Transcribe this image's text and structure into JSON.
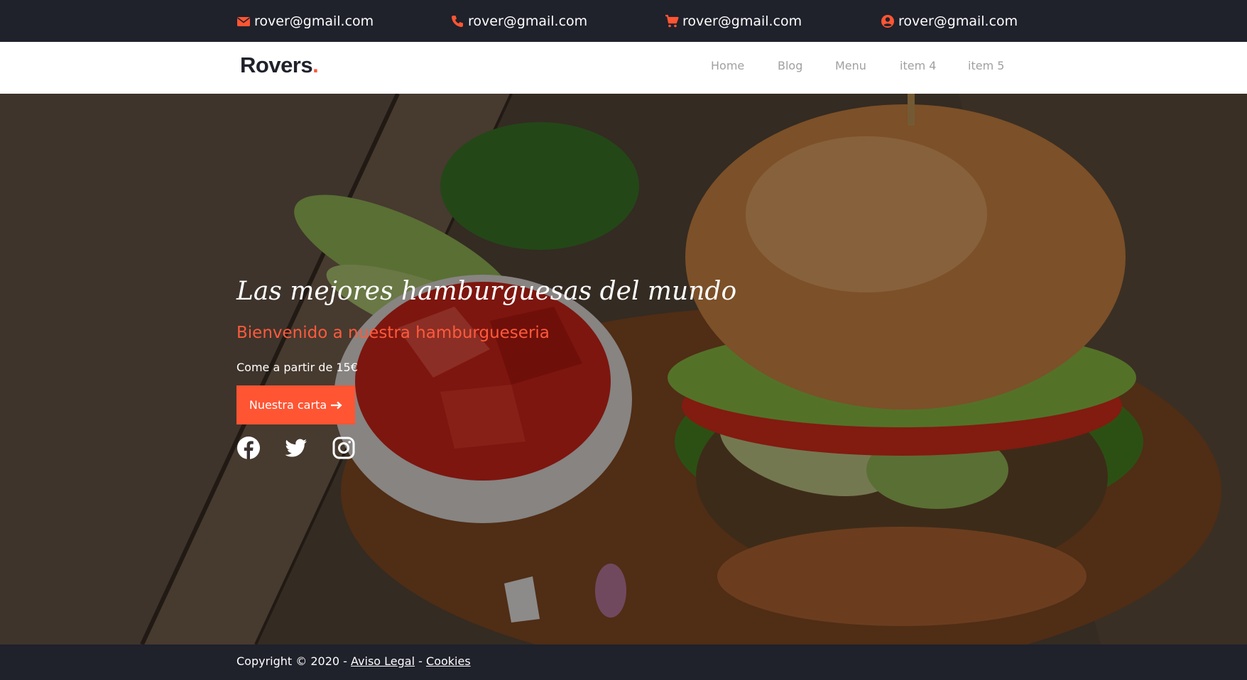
{
  "topbar": {
    "contacts": [
      {
        "icon": "envelope-icon",
        "text": "rover@gmail.com"
      },
      {
        "icon": "phone-icon",
        "text": "rover@gmail.com"
      },
      {
        "icon": "shopping-cart-icon",
        "text": "rover@gmail.com"
      },
      {
        "icon": "user-circle-icon",
        "text": "rover@gmail.com"
      }
    ],
    "icon_color": "#ff5533"
  },
  "navbar": {
    "logo_text": "Rovers",
    "logo_dot": ".",
    "items": [
      "Home",
      "Blog",
      "Menu",
      "item 4",
      "item 5"
    ]
  },
  "hero": {
    "title": "Las mejores hamburguesas del mundo",
    "subtitle": "Bienvenido a nuestra hamburgueseria",
    "text": "Come a partir de 15€",
    "cta_label": "Nuestra carta",
    "cta_icon": "arrow-right-icon",
    "social": [
      "facebook-icon",
      "twitter-icon",
      "instagram-icon"
    ]
  },
  "footer": {
    "copyright": "Copyright © 2020 -",
    "separator": "-",
    "links": [
      "Aviso Legal",
      "Cookies"
    ]
  },
  "colors": {
    "dark": "#1f212b",
    "accent": "#ff5533",
    "nav_text": "#a0a0a0"
  }
}
